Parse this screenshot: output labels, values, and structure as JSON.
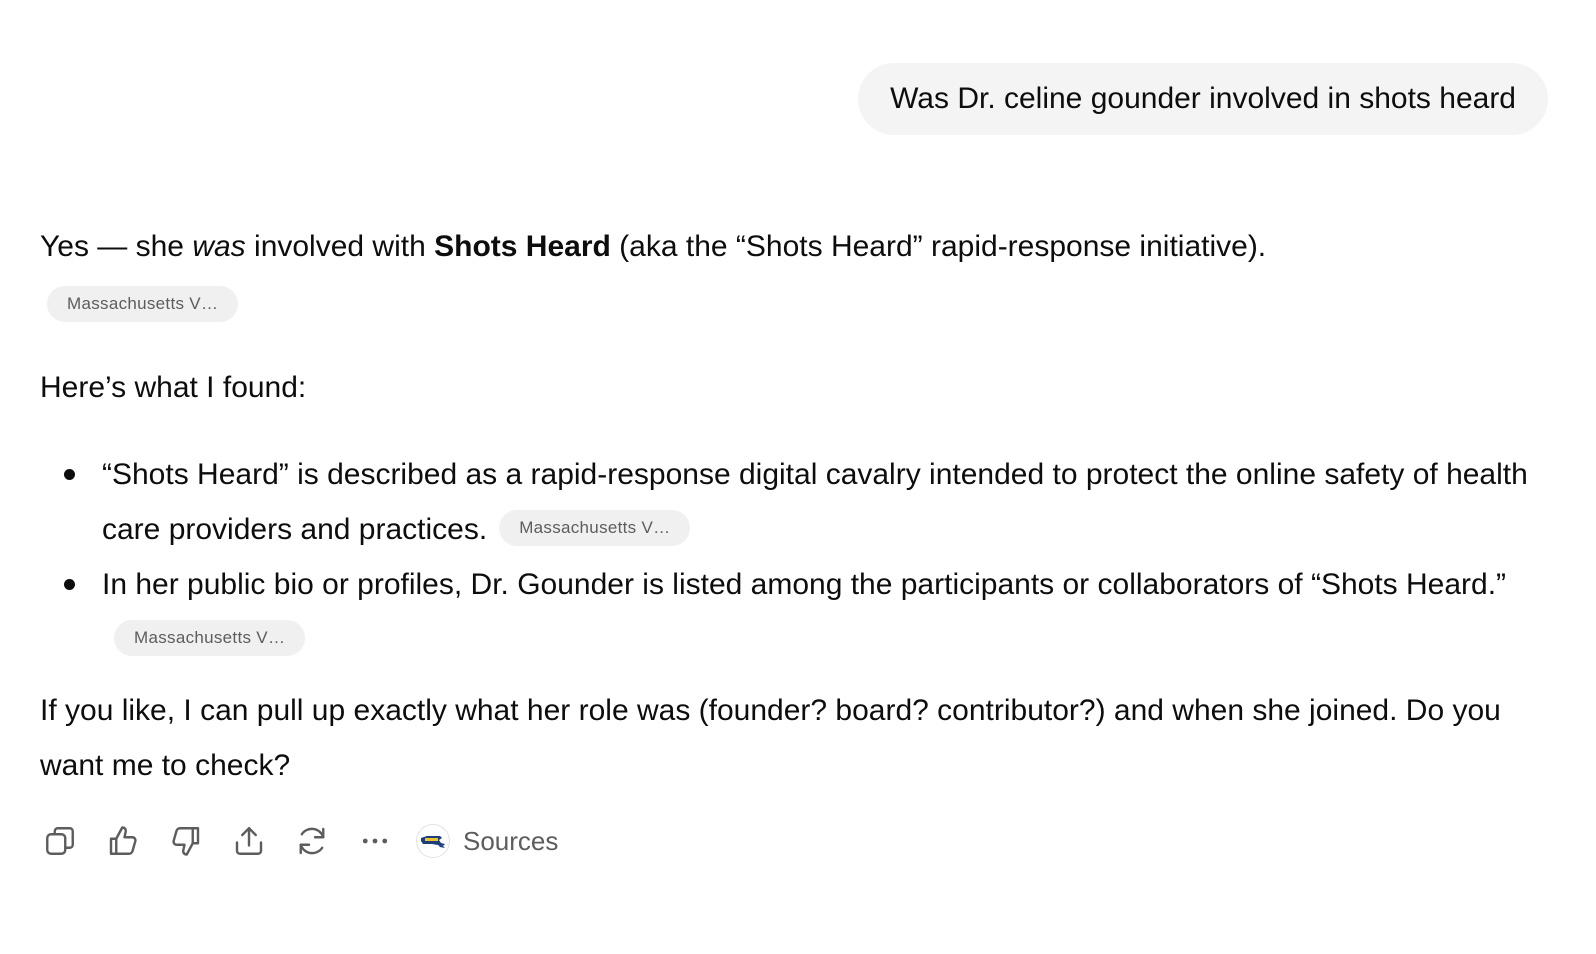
{
  "user_message": {
    "text": "Was Dr. celine gounder involved in shots heard"
  },
  "assistant": {
    "intro": {
      "part1": "Yes — she ",
      "emphasis": "was",
      "part2": " involved with ",
      "strong": "Shots Heard",
      "part3": " (aka the “Shots Heard” rapid-response initiative)."
    },
    "intro_citation": "Massachusetts V…",
    "found_heading": "Here’s what I found:",
    "bullets": [
      {
        "text": "“Shots Heard” is described as a rapid-response digital cavalry intended to protect the online safety of health care providers and practices.",
        "citation": "Massachusetts V…"
      },
      {
        "text": "In her public bio or profiles, Dr. Gounder is listed among the participants or collaborators of “Shots Heard.”",
        "citation": "Massachusetts V…"
      }
    ],
    "closing": "If you like, I can pull up exactly what her role was (founder? board? contributor?) and when she joined. Do you want me to check?"
  },
  "actions": {
    "icons": [
      "copy-icon",
      "thumbs-up-icon",
      "thumbs-down-icon",
      "share-icon",
      "regenerate-icon",
      "more-icon"
    ],
    "sources_label": "Sources"
  },
  "colors": {
    "text": "#0d0d0d",
    "muted": "#5d5d5d",
    "bubble_bg": "#f4f4f4",
    "chip_bg": "#f0f0f0"
  }
}
